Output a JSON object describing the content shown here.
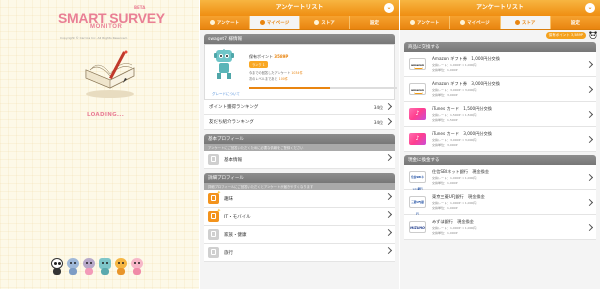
{
  "splash": {
    "logo_smart": "SMART",
    "logo_survey": "SURVEY",
    "logo_beta": "BETA",
    "logo_monitor": "MONITOR",
    "copyright": "Copyright © Carrica Inc. All Rights Reserved.",
    "loading": "LOADING..."
  },
  "app": {
    "title": "アンケートリスト",
    "close_symbol": "⌄",
    "tabs": [
      "アンケート",
      "マイページ",
      "ストア",
      "設定"
    ]
  },
  "mypage": {
    "user_section": "swaget7 様情報",
    "points_label": "保有ポイント",
    "points_value": "3589P",
    "rank_label": "ランク 1",
    "stat1": "今までの回答したアンケート",
    "stat1_value": "1034件",
    "stat2": "次のレベルまであと",
    "stat2_value": "100件",
    "grade_link": "グレードについて",
    "progress": 0.55,
    "rankings": [
      {
        "label": "ポイント獲得ランキング",
        "value": "34位"
      },
      {
        "label": "友だち紹介ランキング",
        "value": "34位"
      }
    ],
    "basic_section": "基本プロフィール",
    "basic_sub": "アンケートにご回答いただくために必要な情報をご登録ください",
    "basic_items": [
      "基本情報"
    ],
    "detail_section": "詳細プロフィール",
    "detail_sub": "詳細プロフィールにご回答いただくとアンケートが届きやすくなります",
    "detail_items": [
      "趣味",
      "IT・モバイル",
      "家族・健康",
      "旅行"
    ]
  },
  "store": {
    "points_pill": "保有ポイント 3,589P",
    "gift_section": "商品に交換する",
    "gifts": [
      {
        "title": "Amazon ギフト券　1,000円分交換",
        "sub1": "交換レート：1,000P ⇒ 1,000円",
        "sub2": "交換単位：1,000P",
        "logo": "amazon"
      },
      {
        "title": "Amazon ギフト券　3,000円分交換",
        "sub1": "交換レート：3,000P ⇒ 3,000円",
        "sub2": "交換単位：3,000P",
        "logo": "amazon"
      },
      {
        "title": "iTunes カード　1,500円分交換",
        "sub1": "交換レート：1,500P ⇒ 1,500円",
        "sub2": "交換単位：1,500P",
        "logo": "itunes"
      },
      {
        "title": "iTunes カード　3,000円分交換",
        "sub1": "交換レート：3,000P ⇒ 3,000円",
        "sub2": "交換単位：3,000P",
        "logo": "itunes"
      }
    ],
    "cash_section": "現金に換金する",
    "banks": [
      {
        "title": "住信SBIネット銀行　現金換金",
        "sub1": "交換レート：1,000P ⇒ 1,000円",
        "sub2": "交換単位：1,000P",
        "logo_text": "住信SBIネット銀行",
        "logo": "bank"
      },
      {
        "title": "東京三菱UFJ銀行　現金換金",
        "sub1": "交換レート：1,000P ⇒ 1,000円",
        "sub2": "交換単位：1,000P",
        "logo_text": "三菱UFJ銀行",
        "logo": "bank"
      },
      {
        "title": "みずほ銀行　現金換金",
        "sub1": "交換レート：1,000P ⇒ 1,000円",
        "sub2": "交換単位：1,000P",
        "logo_text": "MIZUHO",
        "logo": "mizuho"
      }
    ]
  }
}
